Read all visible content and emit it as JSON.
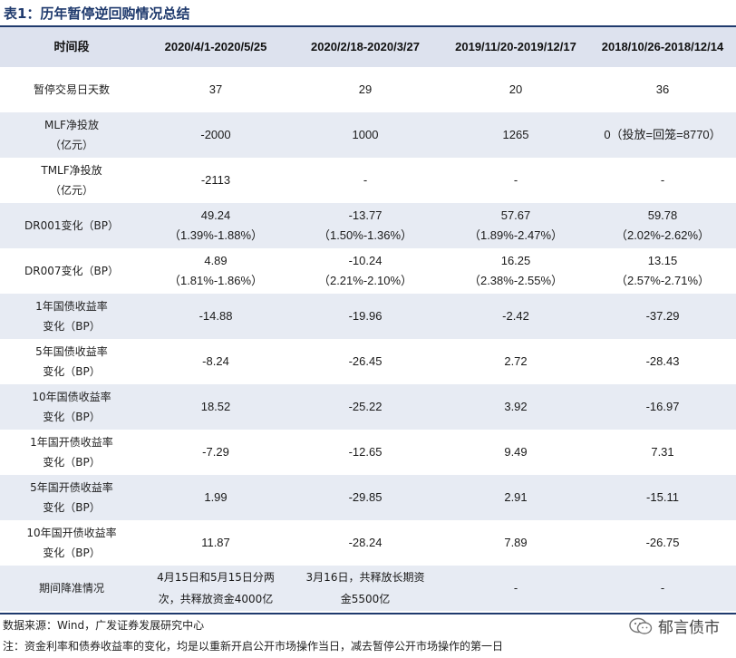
{
  "title": "表1：历年暂停逆回购情况总结",
  "table": {
    "headers": [
      "时间段",
      "2020/4/1-2020/5/25",
      "2020/2/18-2020/3/27",
      "2019/11/20-2019/12/17",
      "2018/10/26-2018/12/14"
    ],
    "rows": [
      {
        "label": [
          "暂停交易日天数"
        ],
        "cells": [
          [
            "37"
          ],
          [
            "29"
          ],
          [
            "20"
          ],
          [
            "36"
          ]
        ]
      },
      {
        "label": [
          "MLF净投放",
          "（亿元）"
        ],
        "cells": [
          [
            "-2000"
          ],
          [
            "1000"
          ],
          [
            "1265"
          ],
          [
            "0（投放=回笼=8770）"
          ]
        ]
      },
      {
        "label": [
          "TMLF净投放",
          "（亿元）"
        ],
        "cells": [
          [
            "-2113"
          ],
          [
            "-"
          ],
          [
            "-"
          ],
          [
            "-"
          ]
        ]
      },
      {
        "label": [
          "DR001变化（BP）"
        ],
        "cells": [
          [
            "49.24",
            "（1.39%-1.88%）"
          ],
          [
            "-13.77",
            "（1.50%-1.36%）"
          ],
          [
            "57.67",
            "（1.89%-2.47%）"
          ],
          [
            "59.78",
            "（2.02%-2.62%）"
          ]
        ]
      },
      {
        "label": [
          "DR007变化（BP）"
        ],
        "cells": [
          [
            "4.89",
            "（1.81%-1.86%）"
          ],
          [
            "-10.24",
            "（2.21%-2.10%）"
          ],
          [
            "16.25",
            "（2.38%-2.55%）"
          ],
          [
            "13.15",
            "（2.57%-2.71%）"
          ]
        ]
      },
      {
        "label": [
          "1年国债收益率",
          "变化（BP）"
        ],
        "cells": [
          [
            "-14.88"
          ],
          [
            "-19.96"
          ],
          [
            "-2.42"
          ],
          [
            "-37.29"
          ]
        ]
      },
      {
        "label": [
          "5年国债收益率",
          "变化（BP）"
        ],
        "cells": [
          [
            "-8.24"
          ],
          [
            "-26.45"
          ],
          [
            "2.72"
          ],
          [
            "-28.43"
          ]
        ]
      },
      {
        "label": [
          "10年国债收益率",
          "变化（BP）"
        ],
        "cells": [
          [
            "18.52"
          ],
          [
            "-25.22"
          ],
          [
            "3.92"
          ],
          [
            "-16.97"
          ]
        ]
      },
      {
        "label": [
          "1年国开债收益率",
          "变化（BP）"
        ],
        "cells": [
          [
            "-7.29"
          ],
          [
            "-12.65"
          ],
          [
            "9.49"
          ],
          [
            "7.31"
          ]
        ]
      },
      {
        "label": [
          "5年国开债收益率",
          "变化（BP）"
        ],
        "cells": [
          [
            "1.99"
          ],
          [
            "-29.85"
          ],
          [
            "2.91"
          ],
          [
            "-15.11"
          ]
        ]
      },
      {
        "label": [
          "10年国开债收益率",
          "变化（BP）"
        ],
        "cells": [
          [
            "11.87"
          ],
          [
            "-28.24"
          ],
          [
            "7.89"
          ],
          [
            "-26.75"
          ]
        ]
      },
      {
        "label": [
          "期间降准情况"
        ],
        "cells": [
          [
            "4月15日和5月15日分两",
            "次，共释放资金4000亿"
          ],
          [
            "3月16日，共释放长期资",
            "金5500亿"
          ],
          [
            "-"
          ],
          [
            "-"
          ]
        ],
        "note": true
      }
    ]
  },
  "footer": {
    "source": "数据来源：Wind，广发证券发展研究中心",
    "note": "注：资金利率和债券收益率的变化，均是以重新开启公开市场操作当日，减去暂停公开市场操作的第一日",
    "brand": "郁言债市",
    "brand_icon": "wechat-icon"
  }
}
